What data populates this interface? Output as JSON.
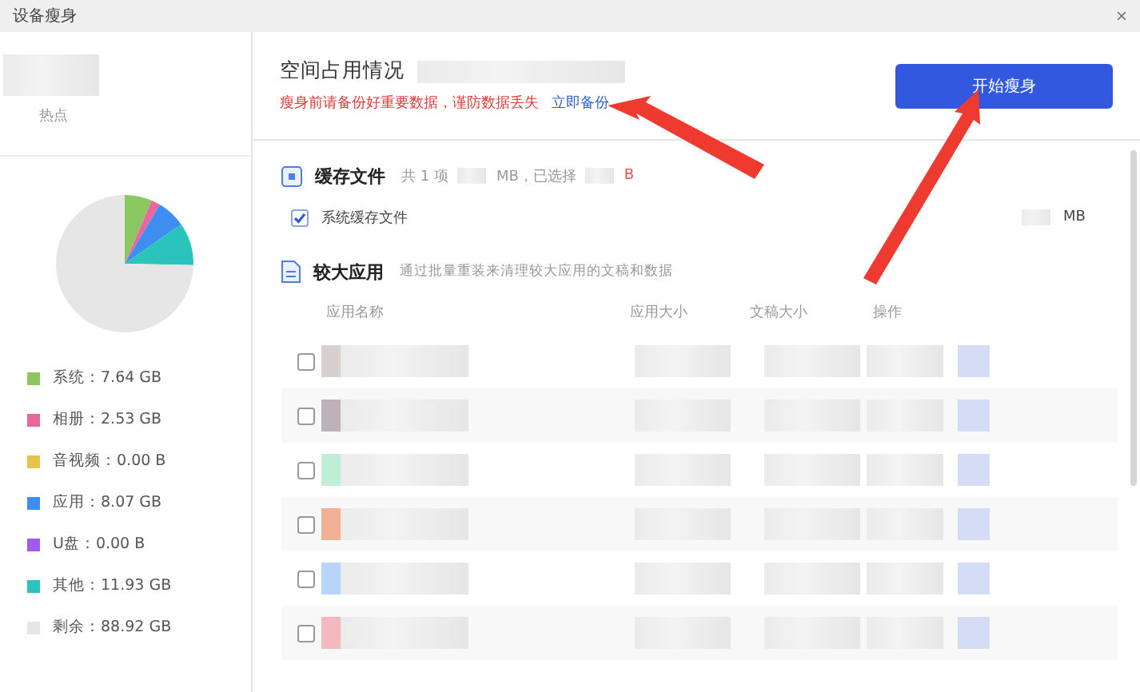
{
  "window": {
    "title": "设备瘦身",
    "close": "×"
  },
  "sidebar": {
    "device_label": "热点",
    "chart_data": {
      "type": "pie",
      "categories": [
        "系统",
        "相册",
        "音视频",
        "应用",
        "U盘",
        "其他",
        "剩余"
      ],
      "values": [
        6.42,
        2.12,
        0,
        6.78,
        0,
        10.02,
        74.66
      ]
    },
    "legend": [
      {
        "value": "：7.64 GB",
        "color": "#8bc861"
      },
      {
        "value": "：2.53 GB",
        "color": "#e8679c"
      },
      {
        "value": "：0.00 B",
        "color": "#e8c24a"
      },
      {
        "value": "：8.07 GB",
        "color": "#3d8ef0"
      },
      {
        "value": "：0.00 B",
        "color": "#a25be8"
      },
      {
        "value": "：11.93 GB",
        "color": "#2bc4bd"
      },
      {
        "value": "：88.92 GB",
        "color": "#e6e6e6"
      }
    ]
  },
  "header": {
    "title": "空间占用情况",
    "warning": "瘦身前请备份好重要数据，谨防数据丢失",
    "backup_link": "立即备份",
    "start_button": "开始瘦身"
  },
  "cache": {
    "title": "缓存文件",
    "count": "共 1 项",
    "size": "MB，已选择",
    "selected_size": "B",
    "items": [
      {
        "label": "系统缓存文件",
        "checked": true,
        "size": "MB"
      }
    ]
  },
  "large_apps": {
    "title": "较大应用",
    "description": "通过批量重装来清理较大应用的文稿和数据",
    "columns": [
      "应用名称",
      "应用大小",
      "文稿大小",
      "操作"
    ],
    "rows": [
      {
        "checked": false
      },
      {
        "checked": false
      },
      {
        "checked": false
      },
      {
        "checked": false
      },
      {
        "checked": false
      },
      {
        "checked": false
      }
    ]
  }
}
